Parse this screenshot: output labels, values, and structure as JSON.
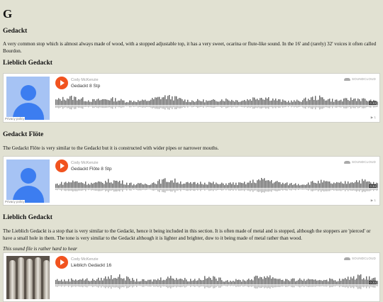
{
  "page": {
    "letter": "G",
    "sections": [
      {
        "heading": "Gedackt",
        "text": "A very common stop which is almost always made of wood, with a stopped adjustable top, it has a very sweet, ocarina or flute-like sound. In the 16' and (rarely) 32' voices it often called Bourdon."
      },
      {
        "heading": "Lieblich Gedackt"
      },
      {
        "heading": "Gedackt Flöte",
        "text": "The Gedackt Flöte is very similar to the Gedackt but it is constructed with wider pipes or narrower mouths."
      },
      {
        "heading": "Lieblich Gedackt",
        "text": "The Lieblich Gedackt is a stop that is very similar to the Gedackt, hence it being included in this section. It is often made of metal and is stopped, although the stoppers are 'pierced' or have a small hole in them. The tone is very similar to the Gedackt although it is lighter and brighter, duw to it being made of metal rather than wood.",
        "note": "This sound file is rather hard to hear"
      }
    ]
  },
  "players": [
    {
      "user": "Cody McKenzie",
      "track": "Gedackt 8 Stp",
      "duration": "0:33",
      "plays": "1",
      "logo": "SOUNDCLOUD",
      "privacy": "Privacy policy",
      "artwork": "avatar-placeholder"
    },
    {
      "user": "Cody McKenzie",
      "track": "Gedackt Flöte 8 Stp",
      "duration": "0:34",
      "plays": "1",
      "logo": "SOUNDCLOUD",
      "privacy": "Privacy policy",
      "artwork": "avatar-placeholder"
    },
    {
      "user": "Cody McKenzie",
      "track": "Lieblich Gedackt 16",
      "duration": "0:33",
      "logo": "SOUNDCLOUD",
      "artwork": "organ-pipes-photo"
    }
  ],
  "colors": {
    "background": "#e1e1d2",
    "play_button": "#f1531f",
    "avatar_bg": "#a6c3f4",
    "avatar_fg": "#3c7df0",
    "waveform": "#666666"
  }
}
